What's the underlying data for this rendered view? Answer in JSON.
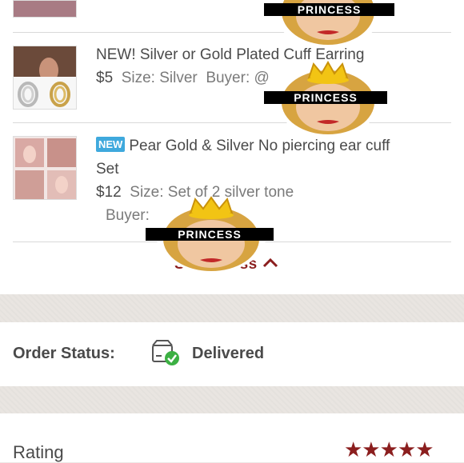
{
  "items": [
    {
      "title_text": "NEW! Silver or Gold Plated Cuff Earring",
      "price": "$5",
      "size_label": "Size:",
      "size_value": "Silver",
      "buyer_label": "Buyer:",
      "buyer_value": "@"
    },
    {
      "badge": "NEW",
      "title_text": "Pear Gold & Silver No piercing ear cuff",
      "title_line2": "Set",
      "price": "$12",
      "size_label": "Size:",
      "size_value": "Set of 2 silver tone",
      "buyer_label": "Buyer:"
    }
  ],
  "sticker_text": "PRINCESS",
  "show_less_label": "Show Less",
  "order_status": {
    "label": "Order Status:",
    "value": "Delivered"
  },
  "rating": {
    "label": "Rating",
    "stars": "★★★★★",
    "star_color": "#8b1e1e"
  },
  "colors": {
    "accent": "#8b1e1e",
    "new_badge": "#3fa9dd",
    "delivered_check": "#3cb043"
  }
}
